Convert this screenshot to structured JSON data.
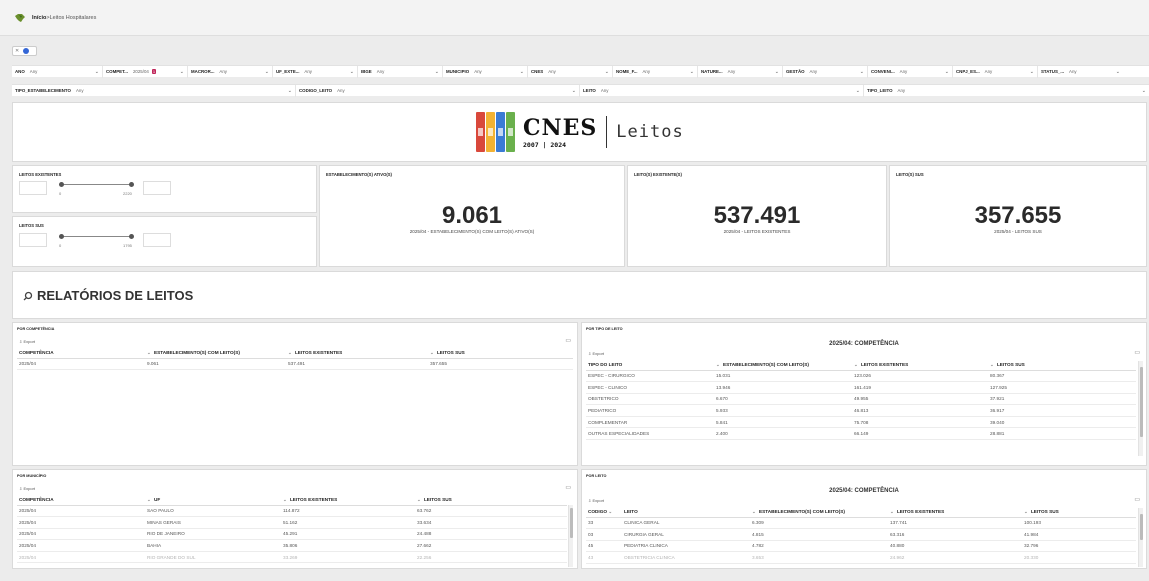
{
  "breadcrumb": {
    "home": "Início",
    "separator": " > ",
    "current": "Leitos Hospitalares"
  },
  "filters_row1": [
    {
      "label": "ANO",
      "value": "Any"
    },
    {
      "label": "COMPET...",
      "value": "2025/04",
      "badge": "1"
    },
    {
      "label": "MACROR...",
      "value": "Any"
    },
    {
      "label": "UF_EXTE...",
      "value": "Any"
    },
    {
      "label": "IBGE",
      "value": "Any"
    },
    {
      "label": "MUNICIPIO",
      "value": "Any"
    },
    {
      "label": "CNES",
      "value": "Any"
    },
    {
      "label": "NOME_F...",
      "value": "Any"
    },
    {
      "label": "NATURE...",
      "value": "Any"
    },
    {
      "label": "GESTÃO",
      "value": "Any"
    },
    {
      "label": "CONVENI...",
      "value": "Any"
    },
    {
      "label": "CNPJ_ES...",
      "value": "Any"
    },
    {
      "label": "STATUS_...",
      "value": "Any"
    }
  ],
  "filters_row2": [
    {
      "label": "TIPO_ESTABELECIMENTO",
      "value": "Any"
    },
    {
      "label": "CODIGO_LEITO",
      "value": "Any"
    },
    {
      "label": "LEITO",
      "value": "Any"
    },
    {
      "label": "TIPO_LEITO",
      "value": "Any"
    }
  ],
  "logo": {
    "title": "CNES",
    "years": "2007 | 2024",
    "subtitle": "Leitos",
    "binder_colors": [
      "#d9483b",
      "#f2b233",
      "#3a7bd5",
      "#6ab04c"
    ]
  },
  "sliders": [
    {
      "title": "LEITOS EXISTENTES",
      "min": "0",
      "max": "2220"
    },
    {
      "title": "LEITOS SUS",
      "min": "0",
      "max": "1795"
    }
  ],
  "kpis": [
    {
      "title": "ESTABELECIMENTO(S) ATIVO(S)",
      "value": "9.061",
      "caption": "2025/04 - ESTABELECIMENTO(S) COM LEITO(S) ATIVO(S)"
    },
    {
      "title": "LEITO(S) EXISTENTE(S)",
      "value": "537.491",
      "caption": "2025/04 - LEITOS EXISTENTES"
    },
    {
      "title": "LEITO(S) SUS",
      "value": "357.655",
      "caption": "2025/04 - LEITOS SUS"
    }
  ],
  "relatorios": {
    "title": "RELATÓRIOS DE LEITOS"
  },
  "export_label": "Export",
  "por_competencia": {
    "title": "POR COMPETÊNCIA",
    "headers": [
      "COMPETÊNCIA",
      "ESTABELECIMENTO(S) COM LEITO(S)",
      "LEITOS EXISTENTES",
      "LEITOS SUS"
    ],
    "rows": [
      [
        "2025/04",
        "9.061",
        "537.491",
        "357.655"
      ]
    ]
  },
  "por_tipo": {
    "title": "POR TIPO DE LEITO",
    "heading": "2025/04: COMPETÊNCIA",
    "headers": [
      "TIPO DO LEITO",
      "ESTABELECIMENTO(S) COM LEITO(S)",
      "LEITOS EXISTENTES",
      "LEITOS SUS"
    ],
    "rows": [
      [
        "ESPEC - CIRURGICO",
        "15.031",
        "123.026",
        "80.367"
      ],
      [
        "ESPEC - CLINICO",
        "13.946",
        "161.419",
        "127.925"
      ],
      [
        "OBSTETRICO",
        "6.670",
        "49.955",
        "37.921"
      ],
      [
        "PEDIATRICO",
        "5.933",
        "46.813",
        "36.917"
      ],
      [
        "COMPLEMENTAR",
        "5.841",
        "75.708",
        "39.040"
      ],
      [
        "OUTRAS ESPECIALIDADES",
        "2.400",
        "66.149",
        "28.881"
      ]
    ]
  },
  "por_municipio": {
    "title": "POR MUNICÍPIO",
    "headers": [
      "COMPETÊNCIA",
      "UF",
      "LEITOS EXISTENTES",
      "LEITOS SUS"
    ],
    "rows": [
      [
        "2025/04",
        "SAO PAULO",
        "114.872",
        "63.762"
      ],
      [
        "2025/04",
        "MINAS GERAIS",
        "51.162",
        "33.634"
      ],
      [
        "2025/04",
        "RIO DE JANEIRO",
        "45.291",
        "24.488"
      ],
      [
        "2025/04",
        "BAHIA",
        "35.806",
        "27.662"
      ],
      [
        "2025/04",
        "RIO GRANDE DO SUL",
        "33.269",
        "22.256"
      ]
    ]
  },
  "por_leito": {
    "title": "POR LEITO",
    "heading": "2025/04: COMPETÊNCIA",
    "headers": [
      "CODIGO",
      "LEITO",
      "ESTABELECIMENTO(S) COM LEITO(S)",
      "LEITOS EXISTENTES",
      "LEITOS SUS"
    ],
    "rows": [
      [
        "33",
        "CLINICA GERAL",
        "6.309",
        "137.741",
        "100.193"
      ],
      [
        "03",
        "CIRURGIA GERAL",
        "4.815",
        "63.316",
        "41.984"
      ],
      [
        "45",
        "PEDIATRIA CLINICA",
        "4.782",
        "40.880",
        "32.796"
      ],
      [
        "43",
        "OBSTETRICIA CLINICA",
        "3.653",
        "24.962",
        "20.330"
      ]
    ]
  }
}
